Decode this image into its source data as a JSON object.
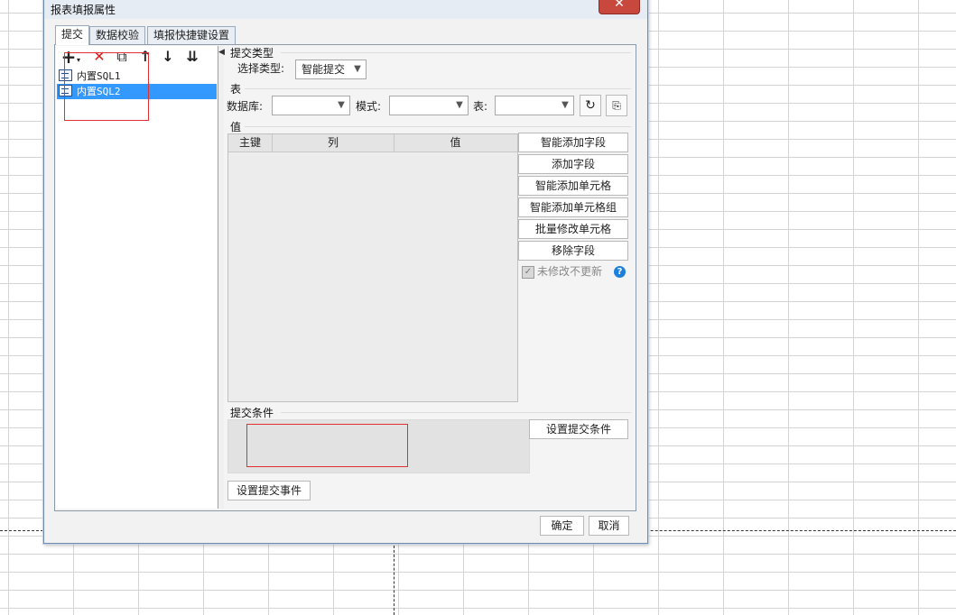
{
  "window": {
    "title": "报表填报属性"
  },
  "tabs": [
    {
      "label": "提交"
    },
    {
      "label": "数据校验"
    },
    {
      "label": "填报快捷键设置"
    }
  ],
  "toolbar": {
    "add": "+",
    "delete": "✕",
    "copy": "⧉",
    "up": "↑",
    "down": "↓",
    "bottom": "⇊"
  },
  "tree": [
    {
      "label": "内置SQL1",
      "selected": false
    },
    {
      "label": "内置SQL2",
      "selected": true
    }
  ],
  "commit_type": {
    "section": "提交类型",
    "label": "选择类型:",
    "value": "智能提交"
  },
  "table_section": {
    "section": "表",
    "db_label": "数据库:",
    "mode_label": "模式:",
    "table_label": "表:"
  },
  "values_section": {
    "section": "值",
    "columns": [
      "主键",
      "列",
      "值"
    ],
    "buttons": [
      "智能添加字段",
      "添加字段",
      "智能添加单元格",
      "智能添加单元格组",
      "批量修改单元格",
      "移除字段"
    ],
    "no_update_label": "未修改不更新"
  },
  "condition": {
    "section": "提交条件",
    "button": "设置提交条件"
  },
  "events_button": "设置提交事件",
  "footer": {
    "ok": "确定",
    "cancel": "取消"
  },
  "colors": {
    "selection": "#3399ff",
    "annotation": "#e03030",
    "help": "#1b7fdc",
    "close": "#c9483e"
  }
}
